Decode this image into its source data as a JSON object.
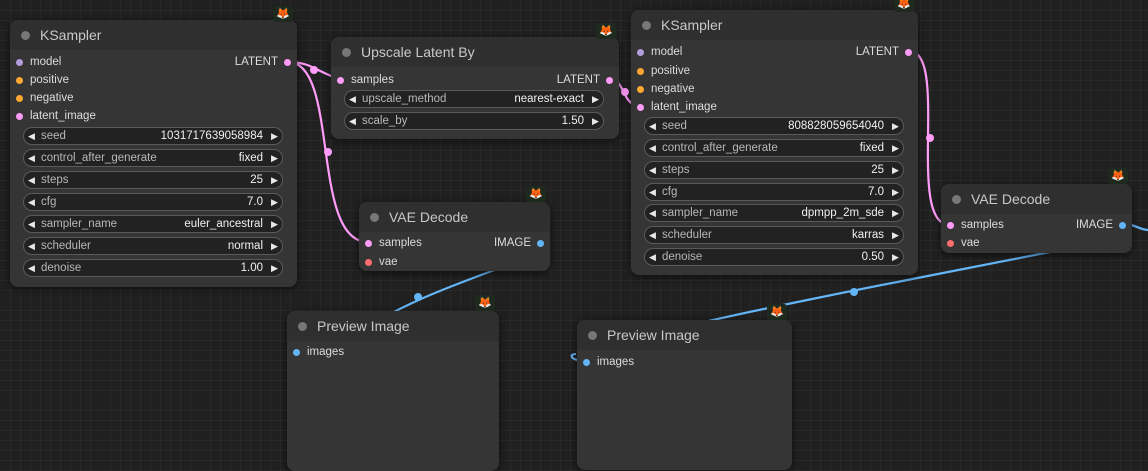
{
  "colors": {
    "latent": "#ff9cf9",
    "model": "#b39ddb",
    "conditioning": "#ffa931",
    "image": "#64b5f6",
    "vae": "#ff6e6e",
    "link_latent": "#ff9cf9",
    "link_image": "#64b5f6"
  },
  "ksampler1": {
    "title": "KSampler",
    "badge_icon": "fox-icon",
    "inputs": [
      "model",
      "positive",
      "negative",
      "latent_image"
    ],
    "output": "LATENT",
    "widgets": [
      {
        "label": "seed",
        "value": "1031717639058984"
      },
      {
        "label": "control_after_generate",
        "value": "fixed"
      },
      {
        "label": "steps",
        "value": "25"
      },
      {
        "label": "cfg",
        "value": "7.0"
      },
      {
        "label": "sampler_name",
        "value": "euler_ancestral"
      },
      {
        "label": "scheduler",
        "value": "normal"
      },
      {
        "label": "denoise",
        "value": "1.00"
      }
    ]
  },
  "upscale": {
    "title": "Upscale Latent By",
    "inputs": [
      "samples"
    ],
    "output": "LATENT",
    "widgets": [
      {
        "label": "upscale_method",
        "value": "nearest-exact"
      },
      {
        "label": "scale_by",
        "value": "1.50"
      }
    ]
  },
  "ksampler2": {
    "title": "KSampler",
    "inputs": [
      "model",
      "positive",
      "negative",
      "latent_image"
    ],
    "output": "LATENT",
    "widgets": [
      {
        "label": "seed",
        "value": "808828059654040"
      },
      {
        "label": "control_after_generate",
        "value": "fixed"
      },
      {
        "label": "steps",
        "value": "25"
      },
      {
        "label": "cfg",
        "value": "7.0"
      },
      {
        "label": "sampler_name",
        "value": "dpmpp_2m_sde"
      },
      {
        "label": "scheduler",
        "value": "karras"
      },
      {
        "label": "denoise",
        "value": "0.50"
      }
    ]
  },
  "vae1": {
    "title": "VAE Decode",
    "inputs": [
      "samples",
      "vae"
    ],
    "output": "IMAGE"
  },
  "vae2": {
    "title": "VAE Decode",
    "inputs": [
      "samples",
      "vae"
    ],
    "output": "IMAGE"
  },
  "preview1": {
    "title": "Preview Image",
    "inputs": [
      "images"
    ]
  },
  "preview2": {
    "title": "Preview Image",
    "inputs": [
      "images"
    ]
  }
}
